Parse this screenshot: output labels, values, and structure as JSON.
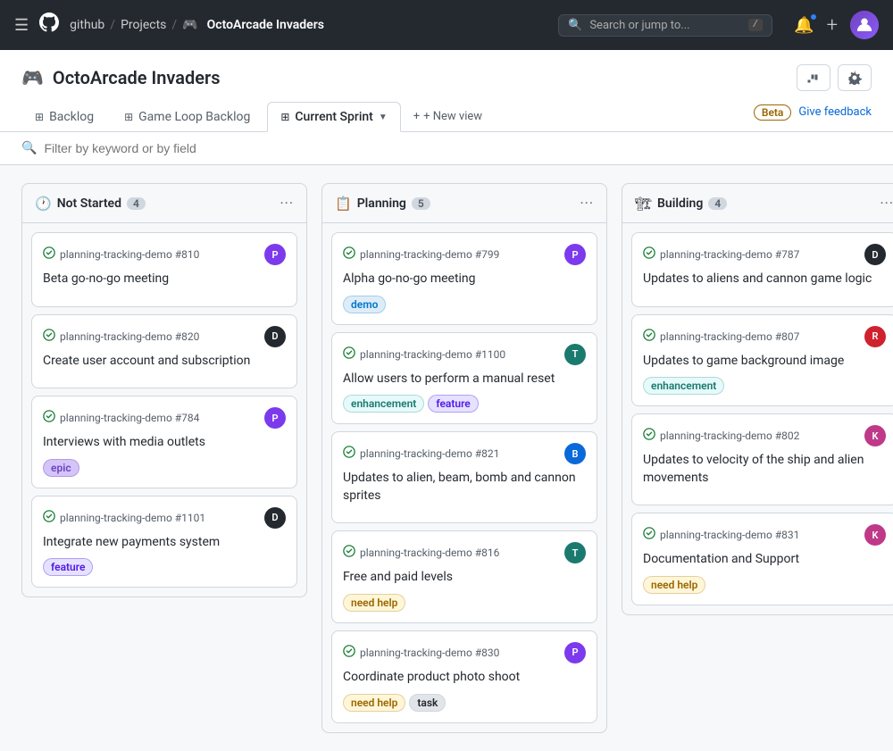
{
  "topNav": {
    "hamburger": "☰",
    "githubLogo": "⬤",
    "breadcrumb": [
      {
        "label": "github",
        "href": "#"
      },
      {
        "label": "Projects",
        "href": "#"
      },
      {
        "label": "OctoArcade Invaders",
        "current": true,
        "emoji": "🎮"
      }
    ],
    "search": {
      "placeholder": "Search or jump to...",
      "shortcut": "/"
    },
    "icons": {
      "notification": "🔔",
      "add": "+"
    }
  },
  "projectHeader": {
    "emoji": "🎮",
    "title": "OctoArcade Invaders",
    "actions": {
      "insights": "⚡",
      "settings": "⚙"
    }
  },
  "tabs": [
    {
      "id": "backlog",
      "label": "Backlog",
      "icon": "⊞",
      "active": false
    },
    {
      "id": "gameloop",
      "label": "Game Loop Backlog",
      "icon": "⊞",
      "active": false
    },
    {
      "id": "currentsprint",
      "label": "Current Sprint",
      "icon": "⊞",
      "active": true
    }
  ],
  "newViewLabel": "+ New view",
  "feedback": {
    "betaLabel": "Beta",
    "linkLabel": "Give feedback"
  },
  "filterBar": {
    "placeholder": "Filter by keyword or by field"
  },
  "columns": [
    {
      "id": "not-started",
      "title": "Not Started",
      "icon": "🕐",
      "count": 4,
      "cards": [
        {
          "id": "card-810",
          "repo": "planning-tracking-demo #810",
          "title": "Beta go-no-go meeting",
          "labels": [],
          "avatarColor": "purple",
          "avatarLetter": "P"
        },
        {
          "id": "card-820",
          "repo": "planning-tracking-demo #820",
          "title": "Create user account and subscription",
          "labels": [],
          "avatarColor": "dark",
          "avatarLetter": "D"
        },
        {
          "id": "card-784",
          "repo": "planning-tracking-demo #784",
          "title": "Interviews with media outlets",
          "labels": [
            {
              "text": "epic",
              "type": "epic"
            }
          ],
          "avatarColor": "purple",
          "avatarLetter": "P"
        },
        {
          "id": "card-1101",
          "repo": "planning-tracking-demo #1101",
          "title": "Integrate new payments system",
          "labels": [
            {
              "text": "feature",
              "type": "feature"
            }
          ],
          "avatarColor": "dark",
          "avatarLetter": "D"
        }
      ]
    },
    {
      "id": "planning",
      "title": "Planning",
      "icon": "📋",
      "count": 5,
      "cards": [
        {
          "id": "card-799",
          "repo": "planning-tracking-demo #799",
          "title": "Alpha go-no-go meeting",
          "labels": [
            {
              "text": "demo",
              "type": "demo"
            }
          ],
          "avatarColor": "purple",
          "avatarLetter": "P"
        },
        {
          "id": "card-1100",
          "repo": "planning-tracking-demo #1100",
          "title": "Allow users to perform a manual reset",
          "labels": [
            {
              "text": "enhancement",
              "type": "enhancement"
            },
            {
              "text": "feature",
              "type": "feature"
            }
          ],
          "avatarColor": "teal",
          "avatarLetter": "T"
        },
        {
          "id": "card-821",
          "repo": "planning-tracking-demo #821",
          "title": "Updates to alien, beam, bomb and cannon sprites",
          "labels": [],
          "avatarColor": "blue",
          "avatarLetter": "B"
        },
        {
          "id": "card-816",
          "repo": "planning-tracking-demo #816",
          "title": "Free and paid levels",
          "labels": [
            {
              "text": "need help",
              "type": "need-help"
            }
          ],
          "avatarColor": "teal",
          "avatarLetter": "T"
        },
        {
          "id": "card-830",
          "repo": "planning-tracking-demo #830",
          "title": "Coordinate product photo shoot",
          "labels": [
            {
              "text": "need help",
              "type": "need-help"
            },
            {
              "text": "task",
              "type": "task"
            }
          ],
          "avatarColor": "purple",
          "avatarLetter": "P"
        }
      ]
    },
    {
      "id": "building",
      "title": "Building",
      "icon": "🏗",
      "count": 4,
      "cards": [
        {
          "id": "card-787",
          "repo": "planning-tracking-demo #787",
          "title": "Updates to aliens and cannon game logic",
          "labels": [],
          "avatarColor": "dark",
          "avatarLetter": "D"
        },
        {
          "id": "card-807",
          "repo": "planning-tracking-demo #807",
          "title": "Updates to game background image",
          "labels": [
            {
              "text": "enhancement",
              "type": "enhancement"
            }
          ],
          "avatarColor": "red",
          "avatarLetter": "R"
        },
        {
          "id": "card-802",
          "repo": "planning-tracking-demo #802",
          "title": "Updates to velocity of the ship and alien movements",
          "labels": [],
          "avatarColor": "pink",
          "avatarLetter": "K"
        },
        {
          "id": "card-831",
          "repo": "planning-tracking-demo #831",
          "title": "Documentation and Support",
          "labels": [
            {
              "text": "need help",
              "type": "need-help"
            }
          ],
          "avatarColor": "pink",
          "avatarLetter": "K"
        }
      ]
    }
  ]
}
